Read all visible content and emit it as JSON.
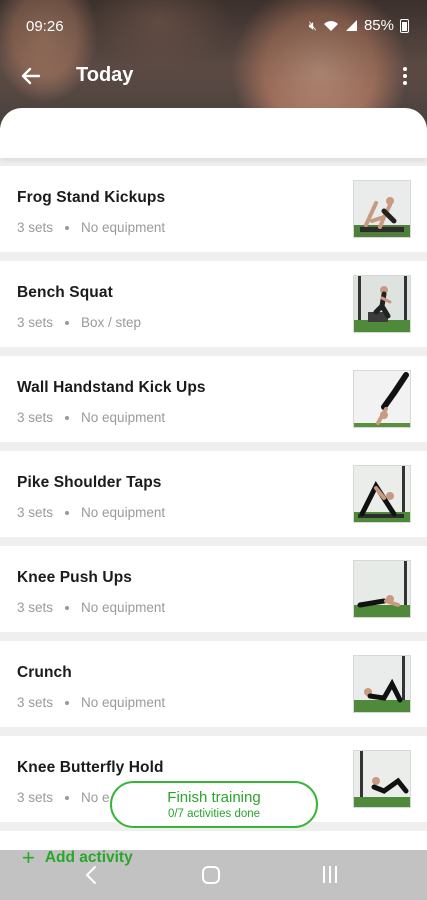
{
  "status": {
    "time": "09:26",
    "battery": "85%",
    "icons": [
      "mute-icon",
      "wifi-icon",
      "signal-icon",
      "battery-icon"
    ]
  },
  "header": {
    "title": "Today"
  },
  "exercises": [
    {
      "name": "Frog Stand Kickups",
      "sets": "3 sets",
      "equipment": "No equipment"
    },
    {
      "name": "Bench Squat",
      "sets": "3 sets",
      "equipment": "Box / step"
    },
    {
      "name": "Wall Handstand Kick Ups",
      "sets": "3 sets",
      "equipment": "No equipment"
    },
    {
      "name": "Pike Shoulder Taps",
      "sets": "3 sets",
      "equipment": "No equipment"
    },
    {
      "name": "Knee Push Ups",
      "sets": "3 sets",
      "equipment": "No equipment"
    },
    {
      "name": "Crunch",
      "sets": "3 sets",
      "equipment": "No equipment"
    },
    {
      "name": "Knee Butterfly Hold",
      "sets": "3 sets",
      "equipment": "No e"
    }
  ],
  "finish": {
    "label": "Finish training",
    "progress": "0/7 activities done"
  },
  "add_activity": {
    "label": "Add activity"
  },
  "colors": {
    "accent": "#36b536",
    "text": "#1b1b1b",
    "muted": "#9a9a9a"
  }
}
